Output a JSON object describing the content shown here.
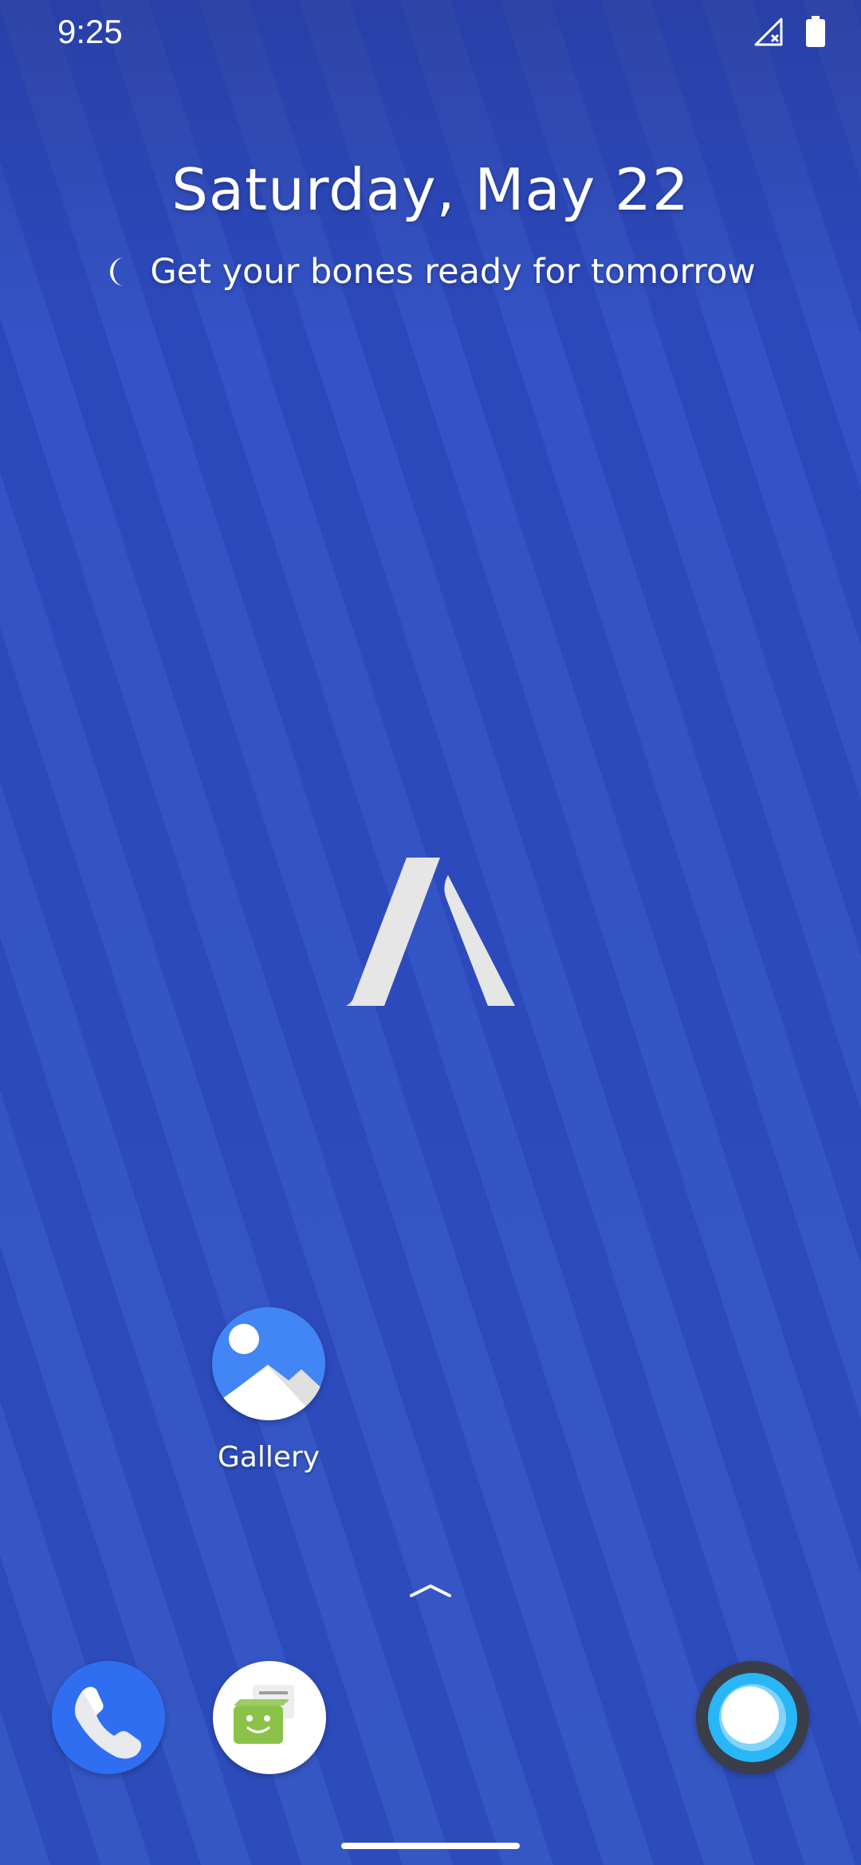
{
  "status_bar": {
    "time": "9:25",
    "icons": [
      "signal-off-icon",
      "battery-full-icon"
    ]
  },
  "home": {
    "date": "Saturday, May 22",
    "tip": {
      "icon": "moon-icon",
      "text": "Get your bones ready for tomorrow"
    },
    "center_logo": "launcher-logo-icon",
    "apps": [
      {
        "label": "Gallery",
        "icon": "gallery-icon"
      }
    ]
  },
  "dock": {
    "apps": [
      {
        "name": "Phone",
        "icon": "phone-icon"
      },
      {
        "name": "Messages",
        "icon": "messages-icon"
      },
      {
        "name": "Assistant",
        "icon": "assistant-icon"
      }
    ]
  },
  "colors": {
    "wallpaper": "#3557c4",
    "gallery": "#4285f4",
    "phone": "#2f6ef0",
    "messages_green": "#8bc34a",
    "assistant_ring": "#3a3d4a"
  }
}
